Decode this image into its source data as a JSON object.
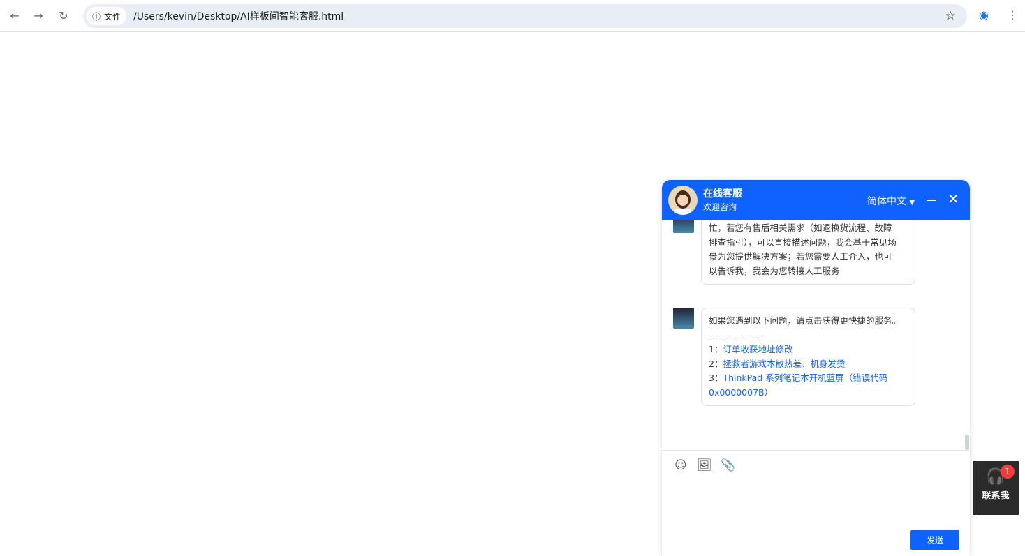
{
  "browser": {
    "chip_label": "文件",
    "url": "/Users/kevin/Desktop/AI样板间智能客服.html"
  },
  "chat": {
    "title": "在线客服",
    "subtitle": "欢迎咨询",
    "language": "简体中文",
    "messages": [
      {
        "lines": [
          "忙，若您有售后相关需求（如退换货流程、故障",
          "排查指引），可以直接描述问题，我会基于常见场",
          "景为您提供解决方案；若您需要人工介入，也可",
          "以告诉我，我会为您转接人工服务"
        ]
      },
      {
        "intro": "如果您遇到以下问题，请点击获得更快捷的服务。",
        "divider": "-----------------",
        "options": [
          {
            "num": "1：",
            "text": "订单收获地址修改"
          },
          {
            "num": "2：",
            "text": "拯救者游戏本散热差、机身发烫"
          },
          {
            "num": "3：",
            "text": "ThinkPad 系列笔记本开机蓝屏（错误代码0x0000007B）"
          }
        ]
      }
    ],
    "send_label": "发送"
  },
  "contact": {
    "label": "联系我",
    "badge": "1"
  },
  "colors": {
    "accent": "#0f62fe",
    "badge": "#f23d3d"
  }
}
